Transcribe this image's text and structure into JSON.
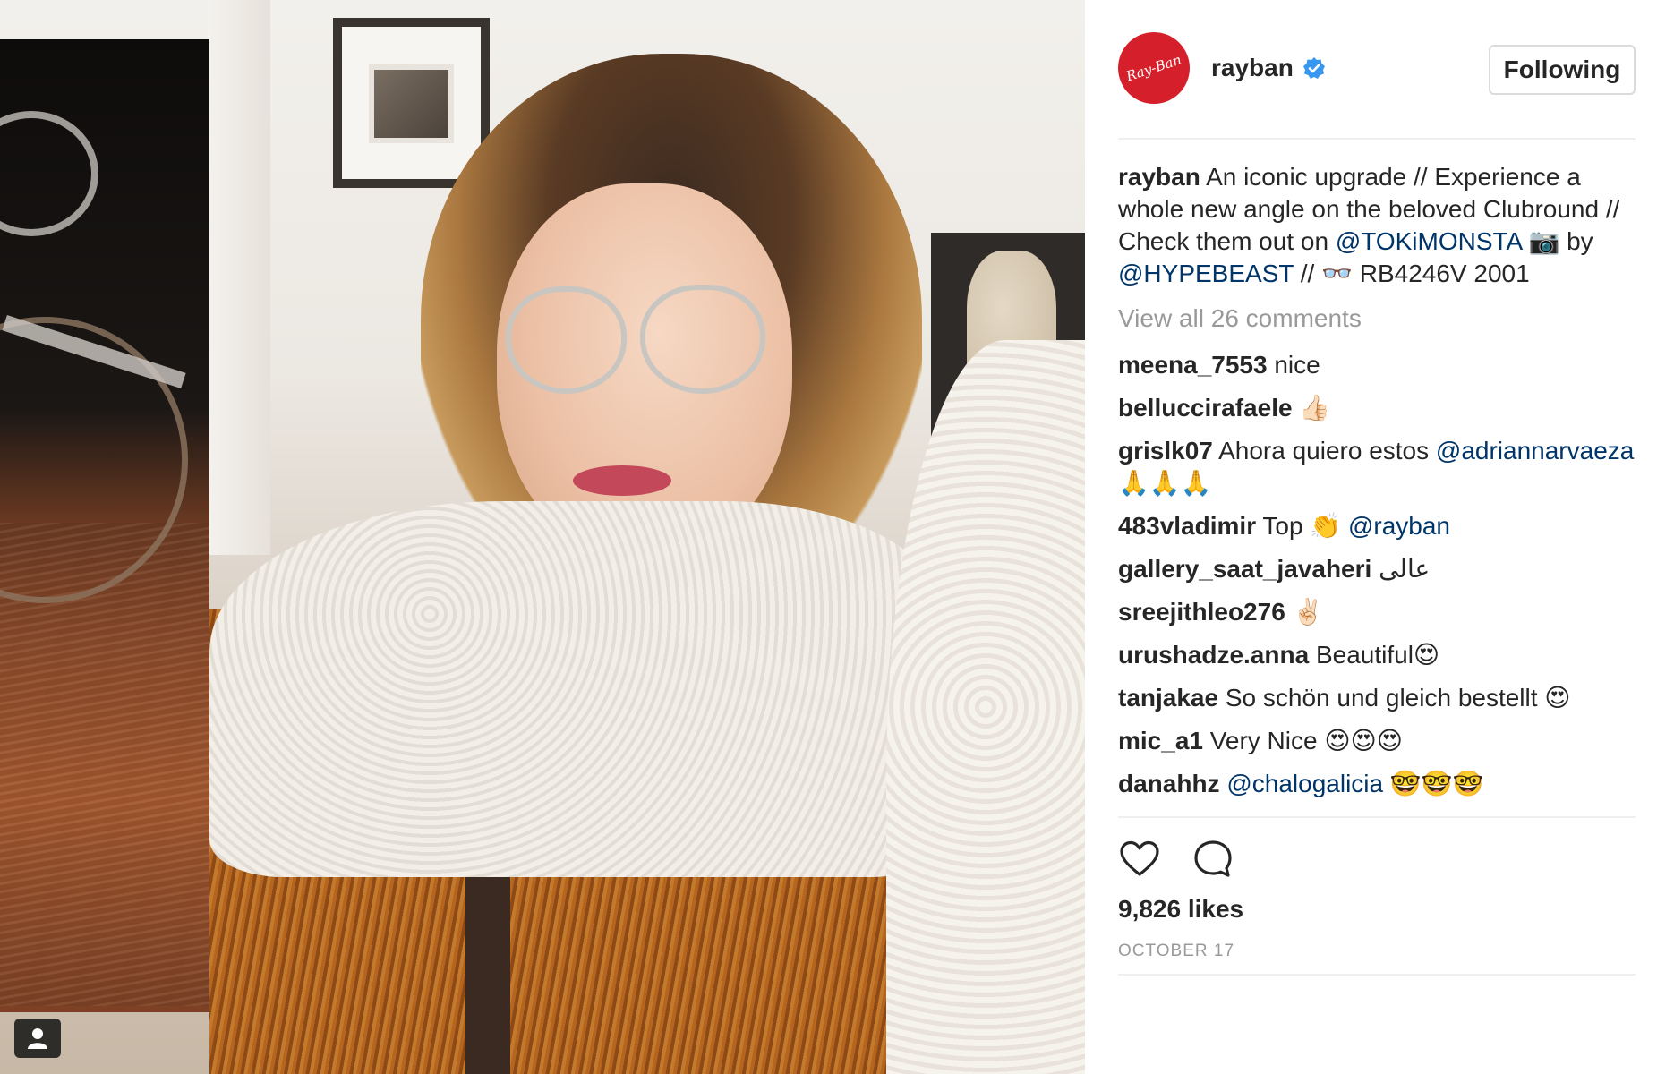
{
  "post": {
    "author": "rayban",
    "avatar_text": "Ray-Ban",
    "follow_button": "Following",
    "caption_user": "rayban",
    "caption_parts": [
      {
        "type": "text",
        "text": " An iconic upgrade // Experience a whole new angle on the beloved Clubround // Check them out on "
      },
      {
        "type": "mention",
        "text": "@TOKiMONSTA"
      },
      {
        "type": "text",
        "text": " 📷 by "
      },
      {
        "type": "mention",
        "text": "@HYPEBEAST"
      },
      {
        "type": "text",
        "text": " // 👓 RB4246V 2001"
      }
    ],
    "view_all": "View all 26 comments",
    "comments": [
      {
        "user": "meena_7553",
        "parts": [
          {
            "type": "text",
            "text": " nice"
          }
        ]
      },
      {
        "user": "belluccirafaele",
        "parts": [
          {
            "type": "text",
            "text": " 👍🏻"
          }
        ]
      },
      {
        "user": "grislk07",
        "parts": [
          {
            "type": "text",
            "text": " Ahora quiero estos "
          },
          {
            "type": "mention",
            "text": "@adriannarvaeza"
          },
          {
            "type": "text",
            "text": " 🙏🙏🙏"
          }
        ]
      },
      {
        "user": "483vladimir",
        "parts": [
          {
            "type": "text",
            "text": " Top 👏 "
          },
          {
            "type": "mention",
            "text": "@rayban"
          }
        ]
      },
      {
        "user": "gallery_saat_javaheri",
        "parts": [
          {
            "type": "text",
            "text": " عالی"
          }
        ]
      },
      {
        "user": "sreejithleo276",
        "parts": [
          {
            "type": "text",
            "text": " ✌🏻"
          }
        ]
      },
      {
        "user": "urushadze.anna",
        "parts": [
          {
            "type": "text",
            "text": " Beautiful😍"
          }
        ]
      },
      {
        "user": "tanjakae",
        "parts": [
          {
            "type": "text",
            "text": " So schön und gleich bestellt 😍"
          }
        ]
      },
      {
        "user": "mic_a1",
        "parts": [
          {
            "type": "text",
            "text": " Very Nice 😍😍😍"
          }
        ]
      },
      {
        "user": "danahhz",
        "parts": [
          {
            "type": "text",
            "text": " "
          },
          {
            "type": "mention",
            "text": "@chalogalicia"
          },
          {
            "type": "text",
            "text": " 🤓🤓🤓"
          }
        ]
      }
    ],
    "likes": "9,826 likes",
    "date": "OCTOBER 17"
  },
  "icons": {
    "like": "heart-outline-icon",
    "comment": "speech-bubble-icon",
    "verified": "verified-badge-icon",
    "user_tag": "person-icon"
  },
  "colors": {
    "avatar_bg": "#d5202b",
    "verified": "#3897f0",
    "mention": "#003569",
    "muted": "#999999",
    "text": "#262626"
  }
}
